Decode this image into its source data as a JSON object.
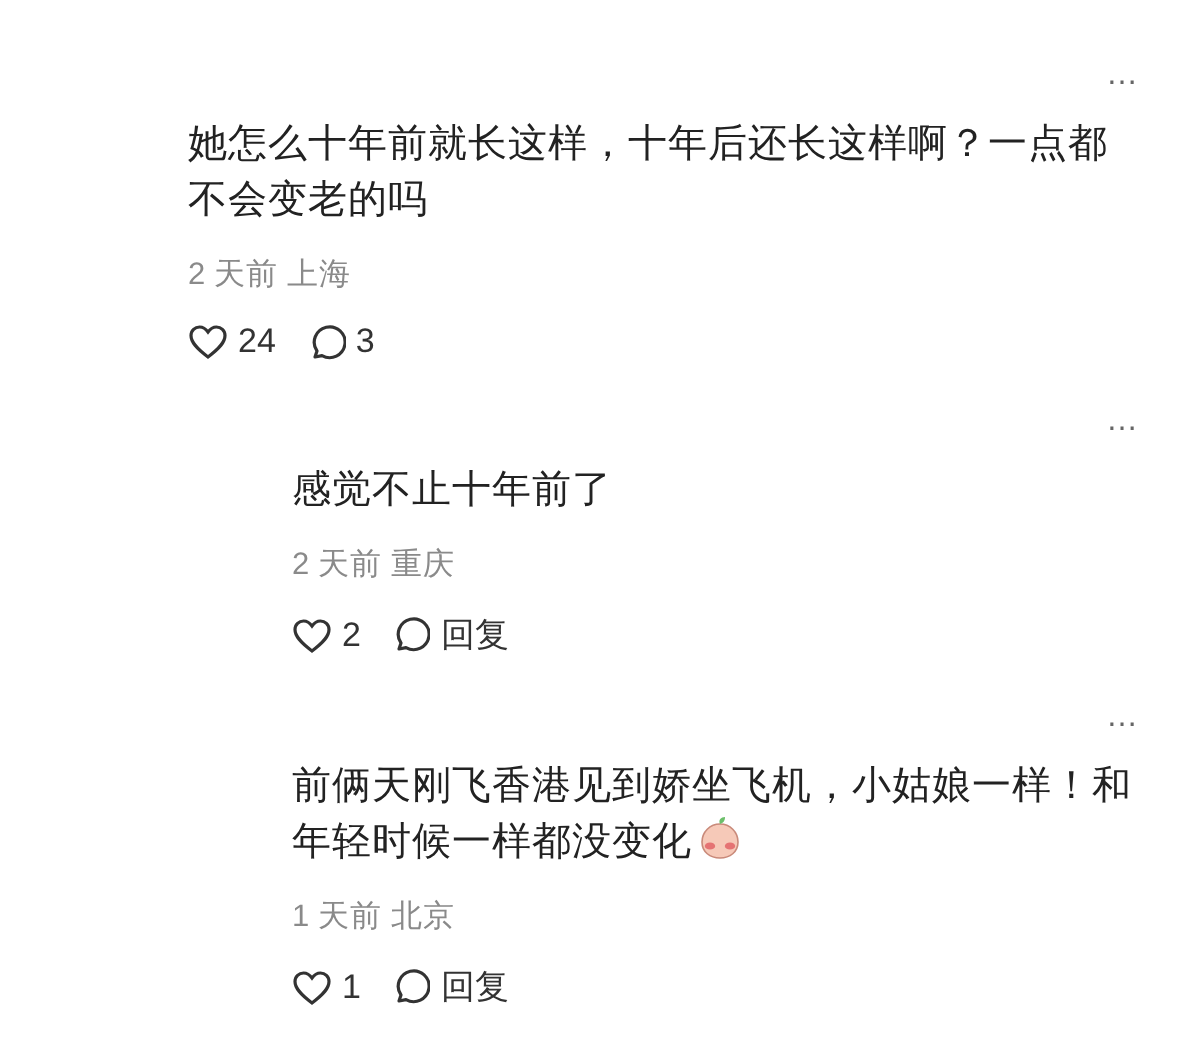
{
  "comments": [
    {
      "text": "她怎么十年前就长这样，十年后还长这样啊？一点都不会变老的吗",
      "sticker": false,
      "time": "2 天前",
      "location": "上海",
      "likes": "24",
      "reply": "3",
      "more": "…",
      "children": [
        {
          "text": "感觉不止十年前了",
          "sticker": false,
          "time": "2 天前",
          "location": "重庆",
          "likes": "2",
          "reply": "回复",
          "more": "…"
        },
        {
          "text": "前俩天刚飞香港见到娇坐飞机，小姑娘一样！和年轻时候一样都没变化",
          "sticker": true,
          "time": "1 天前",
          "location": "北京",
          "likes": "1",
          "reply": "回复",
          "more": "…"
        }
      ]
    }
  ]
}
